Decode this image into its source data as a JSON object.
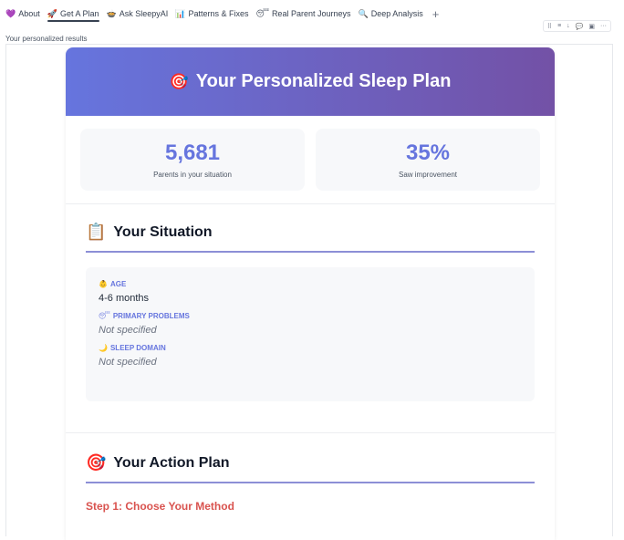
{
  "tabs": [
    {
      "icon": "💜",
      "icon_name": "purple-heart-icon",
      "label": "About",
      "active": false
    },
    {
      "icon": "🚀",
      "icon_name": "rocket-icon",
      "label": "Get A Plan",
      "active": true
    },
    {
      "icon": "🍲",
      "icon_name": "bowl-icon",
      "label": "Ask SleepyAI",
      "active": false
    },
    {
      "icon": "📊",
      "icon_name": "bar-chart-icon",
      "label": "Patterns & Fixes",
      "active": false
    },
    {
      "icon": "😴",
      "icon_name": "sleepy-face-icon",
      "label": "Real Parent Journeys",
      "active": false
    },
    {
      "icon": "🔍",
      "icon_name": "magnifier-icon",
      "label": "Deep Analysis",
      "active": false
    }
  ],
  "add_tab": "+",
  "toolbar": {
    "icons": [
      "⠿",
      "≡",
      "↓",
      "💬",
      "▣",
      "···"
    ]
  },
  "results_caption": "Your personalized results",
  "hero": {
    "emoji": "🎯",
    "title": "Your Personalized Sleep Plan"
  },
  "stats": [
    {
      "value": "5,681",
      "label": "Parents in your situation"
    },
    {
      "value": "35%",
      "label": "Saw improvement"
    }
  ],
  "situation": {
    "emoji": "📋",
    "title": "Your Situation",
    "fields": [
      {
        "emoji": "👶",
        "label": "AGE",
        "value": "4-6 months",
        "muted": false
      },
      {
        "emoji": "😴",
        "label": "PRIMARY PROBLEMS",
        "value": "Not specified",
        "muted": true
      },
      {
        "emoji": "🌙",
        "label": "SLEEP DOMAIN",
        "value": "Not specified",
        "muted": true
      }
    ]
  },
  "action_plan": {
    "emoji": "🎯",
    "title": "Your Action Plan",
    "step_title": "Step 1: Choose Your Method"
  },
  "colors": {
    "accent": "#6675de",
    "gradient_end": "#7351a6",
    "step": "#d9534f"
  }
}
